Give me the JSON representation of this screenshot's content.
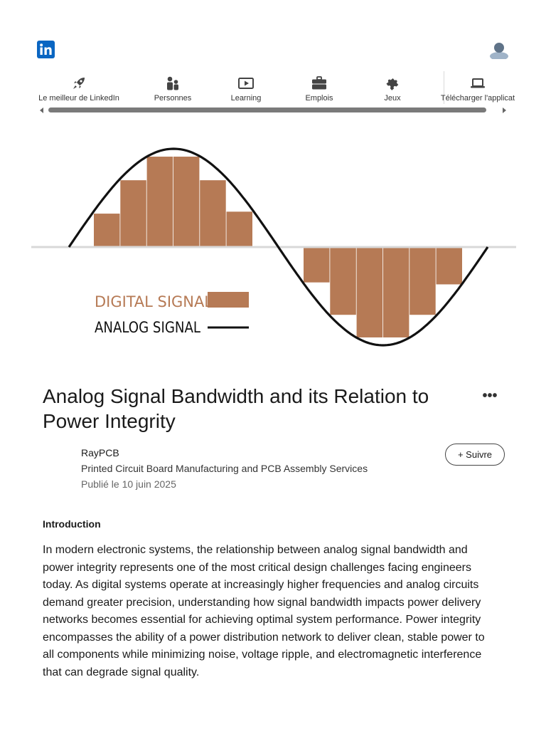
{
  "header": {
    "logo_text": "in",
    "logo_icon": "linkedin-logo",
    "avatar_icon": "user-avatar-icon"
  },
  "nav": {
    "items": [
      {
        "label": "Le meilleur de LinkedIn",
        "icon": "rocket-icon"
      },
      {
        "label": "Personnes",
        "icon": "people-icon"
      },
      {
        "label": "Learning",
        "icon": "video-play-icon"
      },
      {
        "label": "Emplois",
        "icon": "briefcase-icon"
      },
      {
        "label": "Jeux",
        "icon": "puzzle-icon"
      },
      {
        "label": "Télécharger l'applicat",
        "icon": "laptop-icon"
      }
    ]
  },
  "figure": {
    "legend_digital": "DIGITAL SIGNAL",
    "legend_analog": "ANALOG SIGNAL",
    "digital_color": "#b67a55",
    "analog_color": "#111111",
    "bars_positive": [
      0.34,
      0.68,
      0.92,
      0.92,
      0.68,
      0.36
    ],
    "bars_negative": [
      0.36,
      0.69,
      0.92,
      0.92,
      0.69,
      0.38
    ]
  },
  "article": {
    "title": "Analog Signal Bandwidth and its Relation to Power Integrity",
    "more_label": "•••",
    "author": "RayPCB",
    "author_subtitle": "Printed Circuit Board Manufacturing and PCB Assembly Services",
    "published": "Publié le 10 juin 2025",
    "follow_label": "+ Suivre",
    "section_heading": "Introduction",
    "paragraph": "In modern electronic systems, the relationship between analog signal bandwidth and power integrity represents one of the most critical design challenges facing engineers today. As digital systems operate at increasingly higher frequencies and analog circuits demand greater precision, understanding how signal bandwidth impacts power delivery networks becomes essential for achieving optimal system performance. Power integrity encompasses the ability of a power distribution network to deliver clean, stable power to all components while minimizing noise, voltage ripple, and electromagnetic interference that can degrade signal quality."
  }
}
